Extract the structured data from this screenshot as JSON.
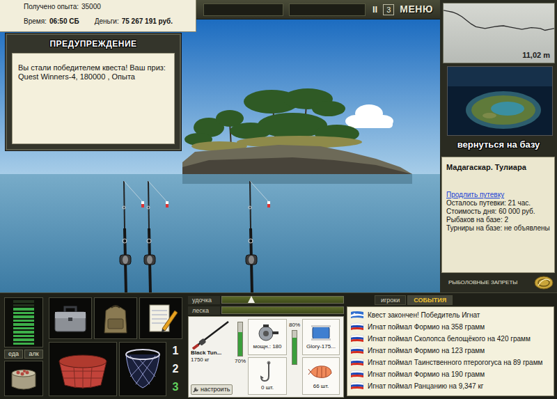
{
  "status": {
    "experience_label": "Получено опыта:",
    "experience": "35000",
    "time_label": "Время:",
    "time": "06:50 СБ",
    "money_label": "Деньги:",
    "money": "75 267 191 руб."
  },
  "toolbar": {
    "pause": "II",
    "speed": "3",
    "menu": "МЕНЮ"
  },
  "dialog": {
    "title": "ПРЕДУПРЕЖДЕНИЕ",
    "message": "Вы стали победителем квеста! Ваш приз: Quest Winners-4, 180000 , Опыта"
  },
  "scene": {
    "rods": [
      {
        "cast": true
      },
      {
        "cast": true
      },
      {
        "cast": true
      }
    ]
  },
  "depth": {
    "values": [
      1.5,
      2,
      2.5,
      3.5,
      5,
      7,
      9,
      10.5,
      11,
      11.5,
      11,
      10.5,
      10.2,
      10,
      10.5,
      11,
      11.5,
      12,
      11.5,
      11,
      11.2,
      11.5,
      12.5,
      12,
      11.5
    ],
    "reading": "11,02 m"
  },
  "location": {
    "back_button": "вернуться на базу",
    "title": "Мадагаскар. Тулиара",
    "extend_link": "Продлить путевку",
    "details": [
      "Осталось путевки: 21 час.",
      "Стоимость дня: 60 000 руб.",
      "Рыбаков на базе: 2",
      "Турниры на базе: не объявлены"
    ],
    "bans": "РЫБОЛОВНЫЕ ЗАПРЕТЫ"
  },
  "player": {
    "meter_level": 0.8,
    "food": "еда",
    "alcohol": "алк"
  },
  "slots": [
    {
      "label": "1",
      "selected": false
    },
    {
      "label": "2",
      "selected": false
    },
    {
      "label": "3",
      "selected": true
    }
  ],
  "indicators": [
    {
      "label": "удочка",
      "level": 0.24,
      "kind": "marker"
    },
    {
      "label": "леска",
      "level": 0,
      "kind": "bar"
    }
  ],
  "tackle": {
    "rod_name": "Black Tun...",
    "rod_load": "1750 кг",
    "rod_level": 0.7,
    "rod_percent": "70%",
    "reel": "мощн.: 180",
    "reel_level": 0.8,
    "reel_percent": "80%",
    "line": "Glory-175...",
    "hook_count": "0 шт.",
    "bait_count": "66 шт.",
    "setup": "настроить"
  },
  "log": {
    "tabs": [
      {
        "label": "игроки",
        "selected": false
      },
      {
        "label": "СОБЫТИЯ",
        "selected": true
      }
    ],
    "events": [
      {
        "text": "Квест закончен! Победитель Игнат",
        "kind": "quest"
      },
      {
        "text": "Игнат поймал Формио на 358 грамм",
        "kind": "catch"
      },
      {
        "text": "Игнат поймал Сколопса белощёкого на 420 грамм",
        "kind": "catch"
      },
      {
        "text": "Игнат поймал Формио на 123 грамм",
        "kind": "catch"
      },
      {
        "text": "Игнат поймал Таинственного птерогогуса на 89 грамм",
        "kind": "catch"
      },
      {
        "text": "Игнат поймал Формио на 190 грамм",
        "kind": "catch"
      },
      {
        "text": "Игнат поймал Ранцанию на 9,347 кг",
        "kind": "catch"
      }
    ]
  }
}
